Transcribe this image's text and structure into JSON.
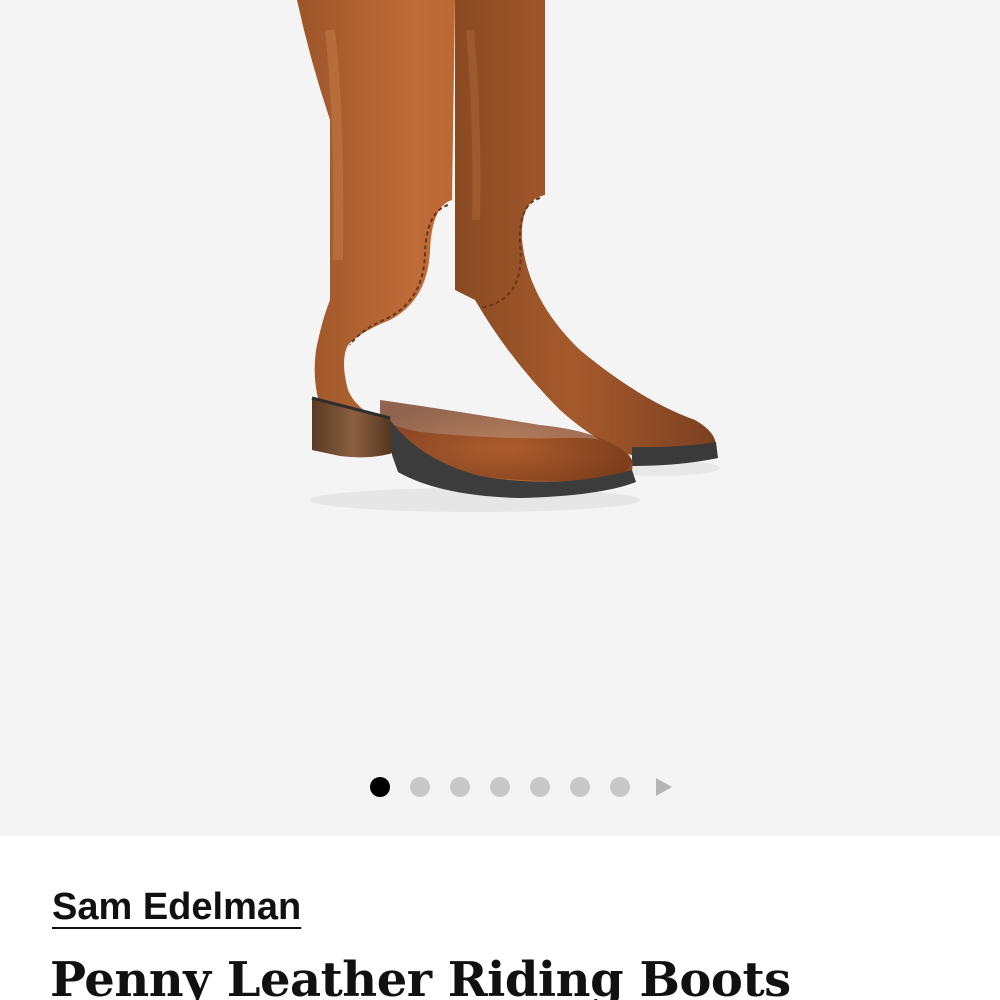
{
  "gallery": {
    "image_icon": "boot-product-image",
    "dot_count": 7,
    "active_index": 0,
    "next_icon": "play-arrow-icon",
    "background_color": "#f4f4f4",
    "boot_color": "#b5612e"
  },
  "product": {
    "brand": "Sam Edelman",
    "title": "Penny Leather Riding Boots"
  }
}
